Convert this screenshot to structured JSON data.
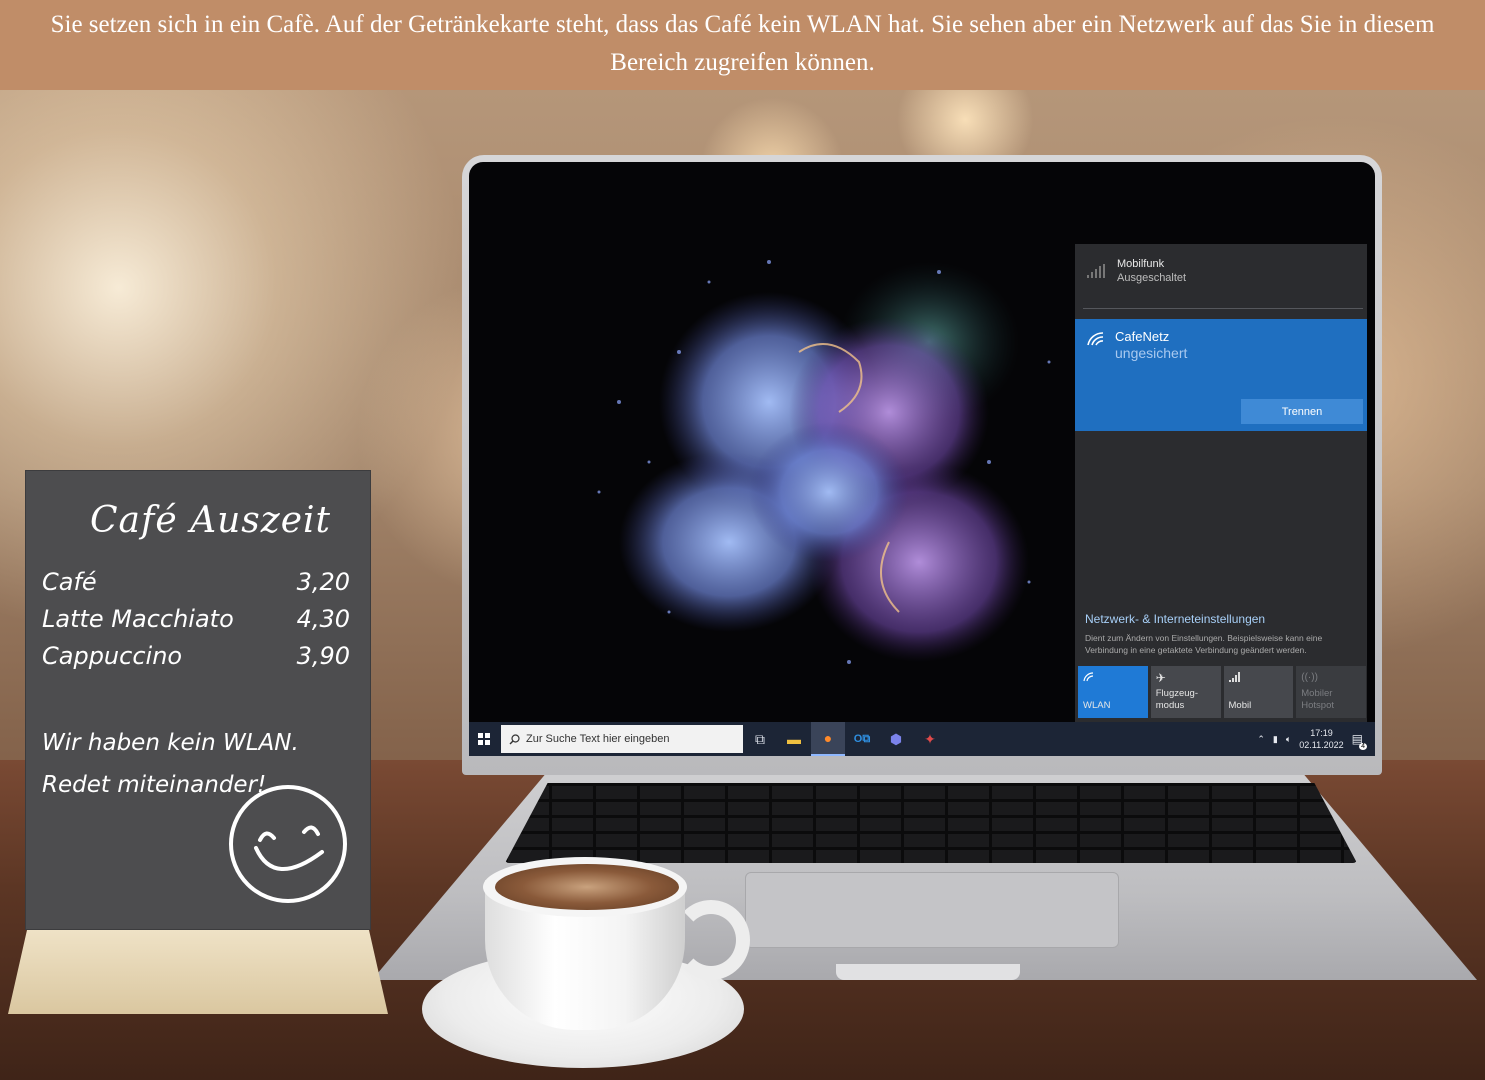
{
  "banner": {
    "text": "Sie setzen sich in ein Cafè. Auf der Getränkekarte steht, dass das Café kein WLAN hat. Sie sehen aber ein Netzwerk auf das Sie in diesem Bereich zugreifen können."
  },
  "sign": {
    "title": "Café Auszeit",
    "menu": [
      {
        "item": "Café",
        "price": "3,20"
      },
      {
        "item": "Latte Macchiato",
        "price": "4,30"
      },
      {
        "item": "Cappuccino",
        "price": "3,90"
      }
    ],
    "note_line1": "Wir haben kein WLAN.",
    "note_line2": "Redet miteinander!"
  },
  "network_flyout": {
    "cellular": {
      "name": "Mobilfunk",
      "status": "Ausgeschaltet",
      "icon": "cellular-signal-icon"
    },
    "wifi": {
      "ssid": "CafeNetz",
      "security": "ungesichert",
      "icon": "wifi-secured-icon",
      "button_label": "Trennen"
    },
    "settings_link": "Netzwerk- & Interneteinstellungen",
    "settings_desc": "Dient zum Ändern von Einstellungen. Beispielsweise kann eine Verbindung in eine getaktete Verbindung geändert werden.",
    "quick_actions": [
      {
        "label": "WLAN",
        "icon": "wifi-icon",
        "state": "on"
      },
      {
        "label": "Flugzeug-\nmodus",
        "icon": "airplane-icon",
        "state": "off"
      },
      {
        "label": "Mobil",
        "icon": "cellular-icon",
        "state": "off"
      },
      {
        "label": "Mobiler\nHotspot",
        "icon": "hotspot-icon",
        "state": "disabled"
      }
    ]
  },
  "taskbar": {
    "search_placeholder": "Zur Suche Text hier eingeben",
    "time": "17:19",
    "date": "02.11.2022",
    "notification_count": "4"
  },
  "colors": {
    "banner": "#c08d68",
    "accent": "#1f6fc0",
    "flyout_bg": "#2b2c2f",
    "taskbar": "#1c2536",
    "chalkboard": "#4d4d4f"
  }
}
